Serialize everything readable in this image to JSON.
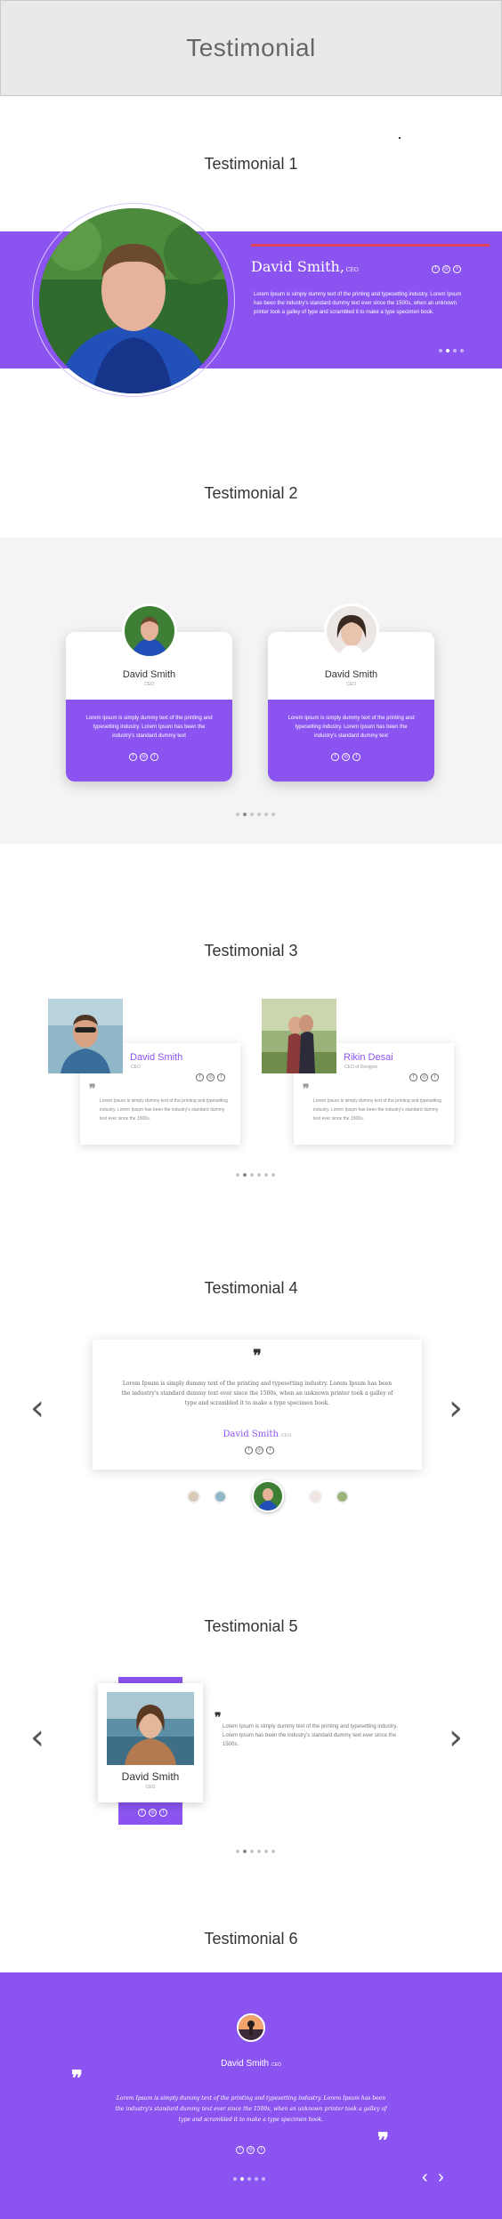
{
  "page": {
    "title": "Testimonial"
  },
  "sections": {
    "t1": {
      "title": "Testimonial 1"
    },
    "t2": {
      "title": "Testimonial 2"
    },
    "t3": {
      "title": "Testimonial 3"
    },
    "t4": {
      "title": "Testimonial 4"
    },
    "t5": {
      "title": "Testimonial 5"
    },
    "t6": {
      "title": "Testimonial 6"
    }
  },
  "t1": {
    "name": "David Smith,",
    "role": "CEO",
    "text": "Lorem Ipsum is simply dummy text of the printing and typesetting industry. Lorem Ipsum has been the industry's standard dummy text ever since the 1500s, when an unknown printer took a galley of type and scrambled it to make a type specimen book."
  },
  "t2": {
    "cards": [
      {
        "name": "David Smith",
        "role": "CEO",
        "text": "Lorem Ipsum is simply dummy text of the printing and typesetting industry. Lorem Ipsum has been the industry's standard dummy text"
      },
      {
        "name": "David Smith",
        "role": "CEO",
        "text": "Lorem Ipsum is simply dummy text of the printing and typesetting industry. Lorem Ipsum has been the industry's standard dummy text"
      }
    ]
  },
  "t3": {
    "cards": [
      {
        "name": "David Smith",
        "role": "CEO",
        "text": "Lorem Ipsum is simply dummy text of the printing and typesetting industry. Lorem Ipsum has been the industry's standard dummy text ever since the 1500s."
      },
      {
        "name": "Rikin Desai",
        "role": "CEO of Designer",
        "text": "Lorem Ipsum is simply dummy text of the printing and typesetting industry. Lorem Ipsum has been the industry's standard dummy text ever since the 1500s."
      }
    ]
  },
  "t4": {
    "text": "Lorem Ipsum is simply dummy text of the printing and typesetting industry. Lorem Ipsum has been the industry's standard dummy text ever since the 1500s, when an unknown printer took a galley of type and scrambled it to make a type specimen book.",
    "name": "David Smith",
    "role": "CEO"
  },
  "t5": {
    "name": "David Smith",
    "role": "CEO",
    "text": "Lorem Ipsum is simply dummy text of the printing and typesetting industry. Lorem Ipsum has been the industry's standard dummy text ever since the 1500s."
  },
  "t6": {
    "name": "David Smith",
    "role": "CEO",
    "text": "Lorem Ipsum is simply dummy text of the printing and typesetting industry. Lorem Ipsum has been the industry's standard dummy text ever since the 1500s, when an unknown printer took a galley of type and scrambled it to make a type specimen book."
  },
  "icons": {
    "facebook": "f",
    "instagram": "◎",
    "twitter": "t",
    "prev": "‹",
    "next": "›",
    "quote": "❞"
  },
  "colors": {
    "accent": "#8b54f0",
    "accent_text": "#8b54f0",
    "red_line": "#e0445a"
  }
}
